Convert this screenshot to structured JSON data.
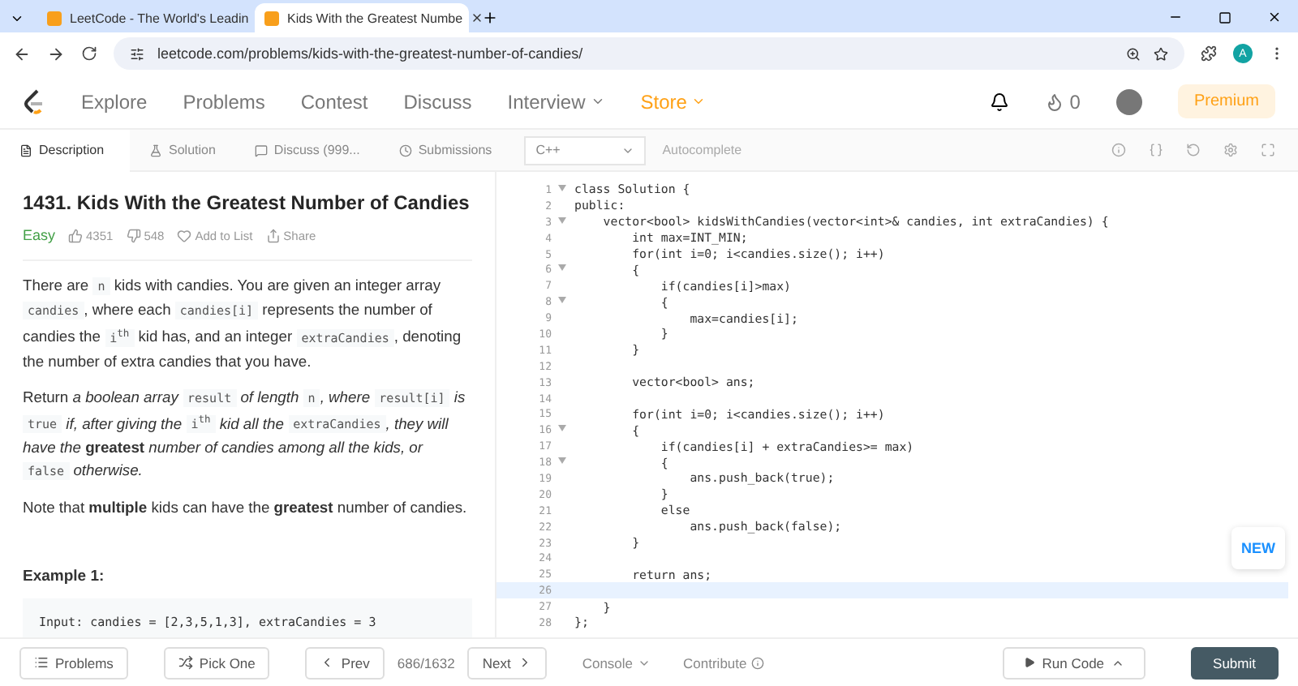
{
  "browser": {
    "tabs": [
      {
        "title": "LeetCode - The World's Leadin",
        "selected": false
      },
      {
        "title": "Kids With the Greatest Numbe",
        "selected": true
      }
    ],
    "url": "leetcode.com/problems/kids-with-the-greatest-number-of-candies/",
    "profile_initial": "A"
  },
  "nav": {
    "items": [
      {
        "label": "Explore",
        "kind": "plain"
      },
      {
        "label": "Problems",
        "kind": "plain"
      },
      {
        "label": "Contest",
        "kind": "plain"
      },
      {
        "label": "Discuss",
        "kind": "plain"
      },
      {
        "label": "Interview",
        "kind": "menu"
      },
      {
        "label": "Store",
        "kind": "store"
      }
    ],
    "coins": "0",
    "premium": "Premium"
  },
  "panel_tabs": [
    {
      "label": "Description",
      "selected": true
    },
    {
      "label": "Solution",
      "selected": false
    },
    {
      "label": "Discuss (999...",
      "selected": false
    },
    {
      "label": "Submissions",
      "selected": false
    }
  ],
  "editor_bar": {
    "language": "C++",
    "autocomplete": "Autocomplete"
  },
  "problem": {
    "title": "1431. Kids With the Greatest Number of Candies",
    "difficulty": "Easy",
    "likes": "4351",
    "dislikes": "548",
    "add_to_list": "Add to List",
    "share": "Share",
    "paragraphs": [
      [
        {
          "kind": "text",
          "text": "There are "
        },
        {
          "kind": "code",
          "text": "n"
        },
        {
          "kind": "text",
          "text": " kids with candies. You are given an integer array "
        },
        {
          "kind": "code",
          "text": "candies"
        },
        {
          "kind": "text",
          "text": ", where each "
        },
        {
          "kind": "code",
          "text": "candies[i]"
        },
        {
          "kind": "text",
          "text": " represents the number of candies the "
        },
        {
          "kind": "code",
          "text": "i$^{th}$"
        },
        {
          "kind": "text",
          "text": " kid has, and an integer "
        },
        {
          "kind": "code",
          "text": "extraCandies"
        },
        {
          "kind": "text",
          "text": ", denoting the number of extra candies that you have."
        }
      ],
      [
        {
          "kind": "text",
          "text": "Return *a boolean array* "
        },
        {
          "kind": "code",
          "text": "result"
        },
        {
          "kind": "text",
          "text": " *of length* "
        },
        {
          "kind": "code",
          "text": "n"
        },
        {
          "kind": "text",
          "text": "*, where* "
        },
        {
          "kind": "code",
          "text": "result[i]"
        },
        {
          "kind": "text",
          "text": " *is* "
        },
        {
          "kind": "code",
          "text": "true"
        },
        {
          "kind": "text",
          "text": " *if, after giving the* "
        },
        {
          "kind": "code",
          "text": "i$^{th}$"
        },
        {
          "kind": "text",
          "text": " *kid all the* "
        },
        {
          "kind": "code",
          "text": "extraCandies"
        },
        {
          "kind": "text",
          "text": "*, they will have the* "
        },
        {
          "kind": "text",
          "text": "**greatest**"
        },
        {
          "kind": "text",
          "text": " *number of candies among all the kids, or* "
        },
        {
          "kind": "code",
          "text": "false"
        },
        {
          "kind": "text",
          "text": " *otherwise.*"
        }
      ],
      [
        {
          "kind": "text",
          "text": "Note that **multiple** kids can have the **greatest** number of candies."
        }
      ]
    ],
    "example_title": "Example 1:",
    "example_input": "Input: candies = [2,3,5,1,3], extraCandies = 3"
  },
  "code": [
    {
      "num": "1",
      "fold": true,
      "current": false,
      "text": "class Solution {"
    },
    {
      "num": "2",
      "fold": false,
      "current": false,
      "text": "public:"
    },
    {
      "num": "3",
      "fold": true,
      "current": false,
      "text": "    vector<bool> kidsWithCandies(vector<int>& candies, int extraCandies) {"
    },
    {
      "num": "4",
      "fold": false,
      "current": false,
      "text": "        int max=INT_MIN;"
    },
    {
      "num": "5",
      "fold": false,
      "current": false,
      "text": "        for(int i=0; i<candies.size(); i++)"
    },
    {
      "num": "6",
      "fold": true,
      "current": false,
      "text": "        {"
    },
    {
      "num": "7",
      "fold": false,
      "current": false,
      "text": "            if(candies[i]>max)"
    },
    {
      "num": "8",
      "fold": true,
      "current": false,
      "text": "            {"
    },
    {
      "num": "9",
      "fold": false,
      "current": false,
      "text": "                max=candies[i];"
    },
    {
      "num": "10",
      "fold": false,
      "current": false,
      "text": "            }"
    },
    {
      "num": "11",
      "fold": false,
      "current": false,
      "text": "        }"
    },
    {
      "num": "12",
      "fold": false,
      "current": false
    },
    {
      "num": "13",
      "fold": false,
      "current": false,
      "text": "        vector<bool> ans;"
    },
    {
      "num": "14",
      "fold": false,
      "current": false
    },
    {
      "num": "15",
      "fold": false,
      "current": false,
      "text": "        for(int i=0; i<candies.size(); i++)"
    },
    {
      "num": "16",
      "fold": true,
      "current": false,
      "text": "        {"
    },
    {
      "num": "17",
      "fold": false,
      "current": false,
      "text": "            if(candies[i] + extraCandies>= max)"
    },
    {
      "num": "18",
      "fold": true,
      "current": false,
      "text": "            {"
    },
    {
      "num": "19",
      "fold": false,
      "current": false,
      "text": "                ans.push_back(true);"
    },
    {
      "num": "20",
      "fold": false,
      "current": false,
      "text": "            }"
    },
    {
      "num": "21",
      "fold": false,
      "current": false,
      "text": "            else"
    },
    {
      "num": "22",
      "fold": false,
      "current": false,
      "text": "                ans.push_back(false);"
    },
    {
      "num": "23",
      "fold": false,
      "current": false,
      "text": "        }"
    },
    {
      "num": "24",
      "fold": false,
      "current": false
    },
    {
      "num": "25",
      "fold": false,
      "current": false,
      "text": "        return ans;"
    },
    {
      "num": "26",
      "fold": false,
      "current": true
    },
    {
      "num": "27",
      "fold": false,
      "current": false,
      "text": "    }"
    },
    {
      "num": "28",
      "fold": false,
      "current": false,
      "text": "};"
    }
  ],
  "new_badge": "NEW",
  "footer": {
    "problems": "Problems",
    "pick_one": "Pick One",
    "prev": "Prev",
    "counter": "686/1632",
    "next": "Next",
    "console": "Console",
    "contribute": "Contribute",
    "run": "Run Code",
    "submit": "Submit"
  }
}
